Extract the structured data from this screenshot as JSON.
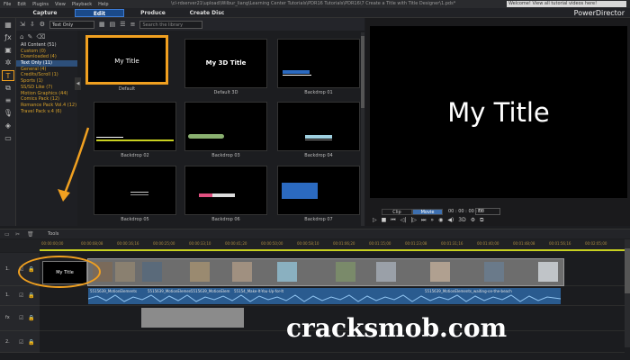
{
  "titlebar": {
    "menu": [
      "File",
      "Edit",
      "Plugins",
      "View",
      "Playback",
      "Help"
    ],
    "path": "\\cl-rdserver21\\upload\\Wilbur_liang\\Learning Center Tutorials\\PDR16 Tutorials\\PDR16\\7 Create a Title with Title Designer\\1.pds*",
    "notice": "Welcome! View all tutorial videos here!"
  },
  "modes": {
    "capture": "Capture",
    "edit": "Edit",
    "produce": "Produce",
    "create_disc": "Create Disc"
  },
  "brand": "PowerDirector",
  "library": {
    "filter": "Text Only",
    "search_placeholder": "Search the library",
    "categories": [
      "All Content (51)",
      "Custom (0)",
      "Downloaded (4)",
      "Text Only (11)",
      "General (4)",
      "Credits/Scroll (1)",
      "Sports (1)",
      "SS/SD Like (7)",
      "Motion Graphics (44)",
      "Comics Pack (12)",
      "Romance Pack Vol.4 (12)",
      "Travel Pack v.4 (6)"
    ],
    "selected_category_index": 3,
    "templates": [
      {
        "name": "Default",
        "thumb_text": "My Title"
      },
      {
        "name": "Default 3D",
        "thumb_text": "My 3D Title"
      },
      {
        "name": "Backdrop 01",
        "thumb_text": ""
      },
      {
        "name": "Backdrop 02",
        "thumb_text": ""
      },
      {
        "name": "Backdrop 03",
        "thumb_text": ""
      },
      {
        "name": "Backdrop 04",
        "thumb_text": ""
      },
      {
        "name": "Backdrop 05",
        "thumb_text": ""
      },
      {
        "name": "Backdrop 06",
        "thumb_text": ""
      },
      {
        "name": "Backdrop 07",
        "thumb_text": ""
      }
    ],
    "selected_template": "Default"
  },
  "preview": {
    "title": "My Title",
    "clip_label": "Clip",
    "movie_label": "Movie",
    "timecode": "00 : 00 : 00 : 00",
    "fit": "Fit",
    "mode_3d": "3D"
  },
  "timeline": {
    "tools_label": "Tools",
    "title_clip_text": "My Title",
    "track_labels": [
      "1.",
      "1.",
      "fx",
      "2."
    ],
    "ruler_marks": [
      "00:00:00;00",
      "00:00:08;08",
      "00:00:16;16",
      "00:00:25;00",
      "00:00:33;10",
      "00:00:41;20",
      "00:00:50;00",
      "00:00:58;10",
      "00:01:06;20",
      "00:01:15;00",
      "00:01:23;08",
      "00:01:31;16",
      "00:01:40;00",
      "00:01:48;08",
      "00:01:56;16",
      "00:02:05;00"
    ],
    "audio_clips": [
      "5515639_MotionElements",
      "5515639_MotionElemen",
      "5515639_MotionElem",
      "55154_Make-It-You-Up-for-It",
      "5515639_MotionElements_waiting-on-the-beach"
    ]
  },
  "watermark": "cracksmob.com",
  "colors": {
    "highlight": "#f0a020",
    "accent": "#1a4a8a",
    "audio": "#2a5b8f"
  }
}
